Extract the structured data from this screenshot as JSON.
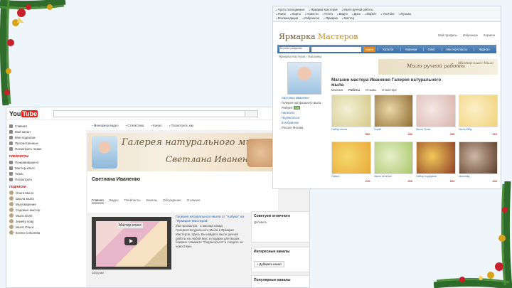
{
  "youtube": {
    "logo_you": "You",
    "logo_tube": "Tube",
    "sidebar": {
      "top_items": [
        {
          "label": "Главная"
        },
        {
          "label": "Мой канал"
        },
        {
          "label": "Мои подписки"
        },
        {
          "label": "Просмотренные"
        },
        {
          "label": "Посмотреть позже"
        }
      ],
      "section1": "ПЛЕЙЛИСТЫ",
      "mid_items": [
        {
          "label": "Понравившиеся"
        },
        {
          "label": "Мастер-класс"
        },
        {
          "label": "Ткань"
        },
        {
          "label": "Посмотреть"
        }
      ],
      "section2": "ПОДПИСКИ",
      "subs": [
        {
          "label": "Ольга Мыло"
        },
        {
          "label": "Школа мыла"
        },
        {
          "label": "Мыловарение"
        },
        {
          "label": "Садовые мастер"
        },
        {
          "label": "Мыло Domi"
        },
        {
          "label": "Jewelry soap"
        },
        {
          "label": "Мыло Ольги"
        },
        {
          "label": "Елена Соболева"
        }
      ]
    },
    "toolbar": [
      "Менеджер видео",
      "Статистика",
      "Канал",
      "Посмотреть как"
    ],
    "banner_title": "Галерея натурального мыла",
    "banner_name": "Светлана Иваненко",
    "channel_name": "Светлана Иваненко",
    "channel_tabs": [
      "Главная",
      "Видео",
      "Плейлисты",
      "Каналы",
      "Обсуждение",
      "О канале"
    ],
    "video_badge": "Мастер-класс",
    "video_title": "Галерея натурального мыла от \"Азбука\" на \"Ярмарке Мастеров\"",
    "video_meta": "252 просмотра · 2 месяца назад",
    "video_desc": "Галерея Натурального Мыла в Ярмарке Мастеров. Здесь Вы найдёте мыло ручной работы на любой вкус и подарки для ваших близких. Нажмите \"Подписаться\" и следите за новостями.",
    "below_label": "Загрузки",
    "right_box1_title": "Советуем отличного",
    "right_box1_text": "Добавить",
    "right_box2_title": "Интересные каналы",
    "right_box2_btn": "+ Добавить канал",
    "right_box3_title": "Популярные каналы"
  },
  "yarmarka": {
    "bookmarks_row1": [
      "Часто посещаемые",
      "Ярмарка Мастеров",
      "Мыло ручной работы"
    ],
    "bookmarks_row2": [
      "Поиск",
      "Карты",
      "Новости",
      "Почта",
      "Видео",
      "Диск",
      "Маркет",
      "YouTube",
      "Музыка"
    ],
    "bookmarks_row3": [
      "Рекомендации",
      "Избранное",
      "Ярмарка",
      "Мастер"
    ],
    "logo_prefix": "Ярмарка ",
    "logo_accent": "Мастеров",
    "header_links": [
      "Мой профиль",
      "Избранное",
      "Корзина"
    ],
    "search_category": "Во всех разделах",
    "search_button": "Найти",
    "nav_tabs": [
      "Каталог",
      "Новинки",
      "Клуб",
      "Мастер-классы",
      "Журнал"
    ],
    "breadcrumb": "Ярмарка Мастеров › Магазины",
    "promo_text": "Мыло ручной работы",
    "promo_small": "Мастер-класс Мыло",
    "shop_title": "Магазин мастера Иваненко Галерея натурального мыла",
    "shop_tabs": [
      "Магазин",
      "Работы",
      "Отзывы",
      "О мастере"
    ],
    "seller_name": "Светлана Иваненко",
    "seller_sub": "Галерея натурального мыла",
    "seller_rating_label": "Рейтинг",
    "seller_rating": "4.9",
    "seller_links": [
      "Написать",
      "Подписаться",
      "В избранное"
    ],
    "seller_location": "Россия, Москва",
    "products": [
      {
        "caption": "Набор мыла",
        "price": "550",
        "color1": "#f3f0d6",
        "color2": "#d4c98a"
      },
      {
        "caption": "Скраб",
        "price": "380",
        "color1": "#e9d9a8",
        "color2": "#8f6a33"
      },
      {
        "caption": "Мыло Розы",
        "price": "250",
        "color1": "#f4e8e4",
        "color2": "#d9b4ae"
      },
      {
        "caption": "Мыло Мёд",
        "price": "220",
        "color1": "#fbf0c8",
        "color2": "#f2d27b"
      },
      {
        "caption": "Лимон",
        "price": "210",
        "color1": "#f7d96c",
        "color2": "#e7a93a"
      },
      {
        "caption": "Мыло зелёное",
        "price": "200",
        "color1": "#e8efc9",
        "color2": "#a9c76c"
      },
      {
        "caption": "Набор подарков",
        "price": "600",
        "color1": "#f1c95a",
        "color2": "#8d3f26"
      },
      {
        "caption": "Шоколад",
        "price": "240",
        "color1": "#cdb8a4",
        "color2": "#5b3b29"
      }
    ]
  },
  "colors": {
    "youtube_red": "#e62117",
    "yarmarka_blue": "#3a6ea5",
    "yarmarka_orange": "#e58a1f"
  }
}
